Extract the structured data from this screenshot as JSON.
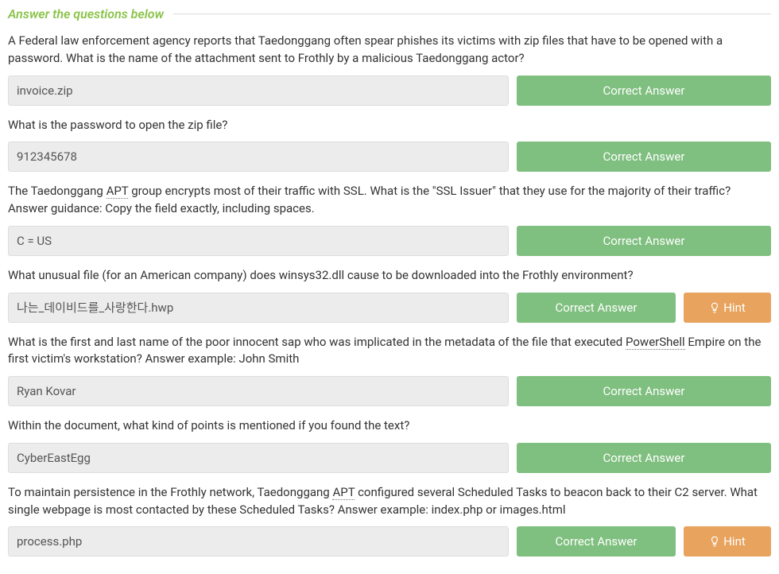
{
  "header": {
    "title": "Answer the questions below"
  },
  "labels": {
    "correct": "Correct Answer",
    "hint": "Hint"
  },
  "questions": [
    {
      "text_parts": [
        {
          "t": "A Federal law enforcement agency reports that Taedonggang often spear phishes its victims with zip files that have to be opened with a password. What is the name of the attachment sent to Frothly by a malicious Taedonggang actor?"
        }
      ],
      "answer": "invoice.zip",
      "has_hint": false
    },
    {
      "text_parts": [
        {
          "t": "What is the password to open the zip file?"
        }
      ],
      "answer": "912345678",
      "has_hint": false
    },
    {
      "text_parts": [
        {
          "t": "The Taedonggang "
        },
        {
          "t": "APT",
          "dotted": true
        },
        {
          "t": " group encrypts most of their traffic with SSL. What is the \"SSL Issuer\" that they use for the majority of their traffic? Answer guidance: Copy the field exactly, including spaces."
        }
      ],
      "answer": "C = US",
      "has_hint": false
    },
    {
      "text_parts": [
        {
          "t": "What unusual file (for an American company) does winsys32.dll cause to be downloaded into the Frothly environment?"
        }
      ],
      "answer": "나는_데이비드를_사랑한다.hwp",
      "has_hint": true
    },
    {
      "text_parts": [
        {
          "t": "What is the first and last name of the poor innocent sap who was implicated in the metadata of the file that executed "
        },
        {
          "t": "PowerShell",
          "dotted": true
        },
        {
          "t": " Empire on the first victim's workstation? Answer example: John Smith"
        }
      ],
      "answer": "Ryan Kovar",
      "has_hint": false
    },
    {
      "text_parts": [
        {
          "t": "Within the document, what kind of points is mentioned if you found the text?"
        }
      ],
      "answer": "CyberEastEgg",
      "has_hint": false
    },
    {
      "text_parts": [
        {
          "t": "To maintain persistence in the Frothly network, Taedonggang "
        },
        {
          "t": "APT",
          "dotted": true
        },
        {
          "t": " configured several Scheduled Tasks to beacon back to their C2 server. What single webpage is most contacted by these Scheduled Tasks? Answer example: index.php or images.html"
        }
      ],
      "answer": "process.php",
      "has_hint": true
    }
  ]
}
